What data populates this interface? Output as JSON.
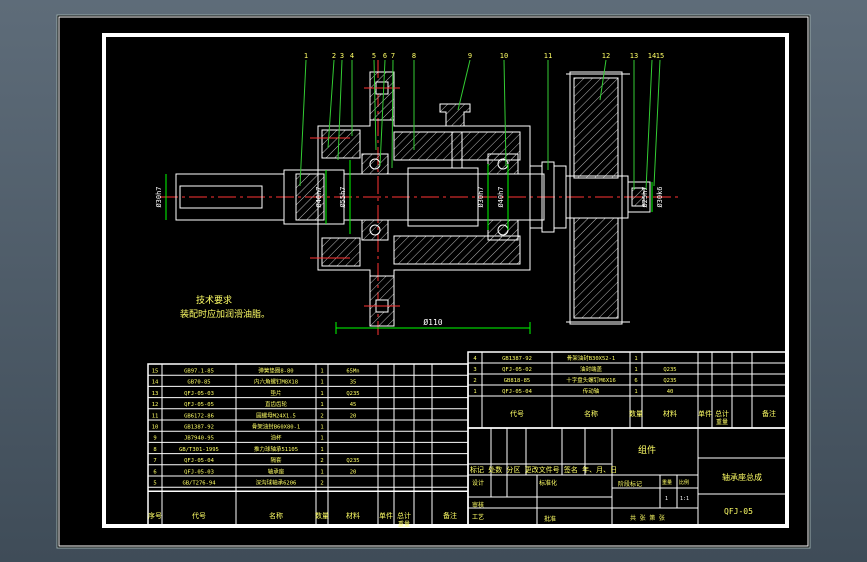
{
  "colors": {
    "paper": "#000000",
    "frame": "#ffffff",
    "part": "#ffffff",
    "dim": "#00ff00",
    "center": "#ff3333",
    "leader": "#33cc33",
    "accent": "#ffff00",
    "text": "#ffff66",
    "hatch": "#bbbbbb"
  },
  "leaders": [
    "1",
    "2",
    "3",
    "4",
    "5",
    "6",
    "7",
    "8",
    "9",
    "10",
    "11",
    "12",
    "13",
    "14",
    "15"
  ],
  "dims": {
    "d1": "Ø30h7",
    "d2": "Ø40h7",
    "d3": "Ø55h7",
    "d4": "Ø110",
    "d5": "Ø30h7",
    "d6": "Ø40h7",
    "d7": "Ø25h7",
    "d8": "Ø30k6"
  },
  "notes": {
    "title": "技术要求",
    "line1": "装配时应加润滑油脂。"
  },
  "left_bom": {
    "rows": [
      {
        "no": "15",
        "code": "GB97.1-85",
        "name": "弹簧垫圈8-80",
        "qty": "1",
        "mat": "65Mn"
      },
      {
        "no": "14",
        "code": "GB70-85",
        "name": "内六角螺钉M8X18",
        "qty": "1",
        "mat": "35"
      },
      {
        "no": "13",
        "code": "QFJ-05-03",
        "name": "垫片",
        "qty": "1",
        "mat": "Q235"
      },
      {
        "no": "12",
        "code": "QFJ-05-05",
        "name": "直齿齿轮",
        "qty": "1",
        "mat": "45"
      },
      {
        "no": "11",
        "code": "GB6172-86",
        "name": "圆螺母M24X1.5",
        "qty": "2",
        "mat": "20"
      },
      {
        "no": "10",
        "code": "GB1387-92",
        "name": "骨架油封B60X80-1",
        "qty": "1",
        "mat": ""
      },
      {
        "no": "9",
        "code": "JB7940-95",
        "name": "油杯",
        "qty": "1",
        "mat": ""
      },
      {
        "no": "8",
        "code": "GB/T301-1995",
        "name": "推力球轴承51105",
        "qty": "1",
        "mat": ""
      },
      {
        "no": "7",
        "code": "QFJ-05-04",
        "name": "隔套",
        "qty": "2",
        "mat": "Q235"
      },
      {
        "no": "6",
        "code": "QFJ-05-03",
        "name": "轴承座",
        "qty": "1",
        "mat": "20"
      },
      {
        "no": "5",
        "code": "GB/T276-94",
        "name": "深沟球轴承6206",
        "qty": "2",
        "mat": ""
      }
    ],
    "header": {
      "no": "序号",
      "code": "代号",
      "name": "名称",
      "qty": "数量",
      "mat": "材料",
      "w1": "单件",
      "w2": "总计",
      "weight": "重量",
      "note": "备注"
    }
  },
  "right_bom": {
    "rows": [
      {
        "no": "4",
        "code": "GB1387-92",
        "name": "骨架油封B30X52-1",
        "qty": "1",
        "mat": ""
      },
      {
        "no": "3",
        "code": "QFJ-05-02",
        "name": "油封端盖",
        "qty": "1",
        "mat": "Q235"
      },
      {
        "no": "2",
        "code": "GB818-85",
        "name": "十字盘头螺钉M6X16",
        "qty": "6",
        "mat": "Q235"
      },
      {
        "no": "1",
        "code": "QFJ-05-04",
        "name": "传动轴",
        "qty": "1",
        "mat": "40"
      }
    ],
    "header": {
      "code": "代号",
      "name": "名称",
      "qty": "数量",
      "mat": "材料",
      "w1": "单件",
      "w2": "总计",
      "weight": "重量",
      "note": "备注"
    }
  },
  "title_block": {
    "group": "组件",
    "drawing_name": "轴承座总成",
    "drawing_no": "QFJ-05",
    "rev_row": "标记 处数 分区 更改文件号 签名 年、月、日",
    "design": "设计",
    "standard": "标准化",
    "stage": "阶段标记",
    "weight": "重量",
    "scale": "比例",
    "scale_val": "1:1",
    "qty_val": "1",
    "review": "审核",
    "process": "工艺",
    "approve": "批准",
    "sheets": "共 张 第 张"
  }
}
